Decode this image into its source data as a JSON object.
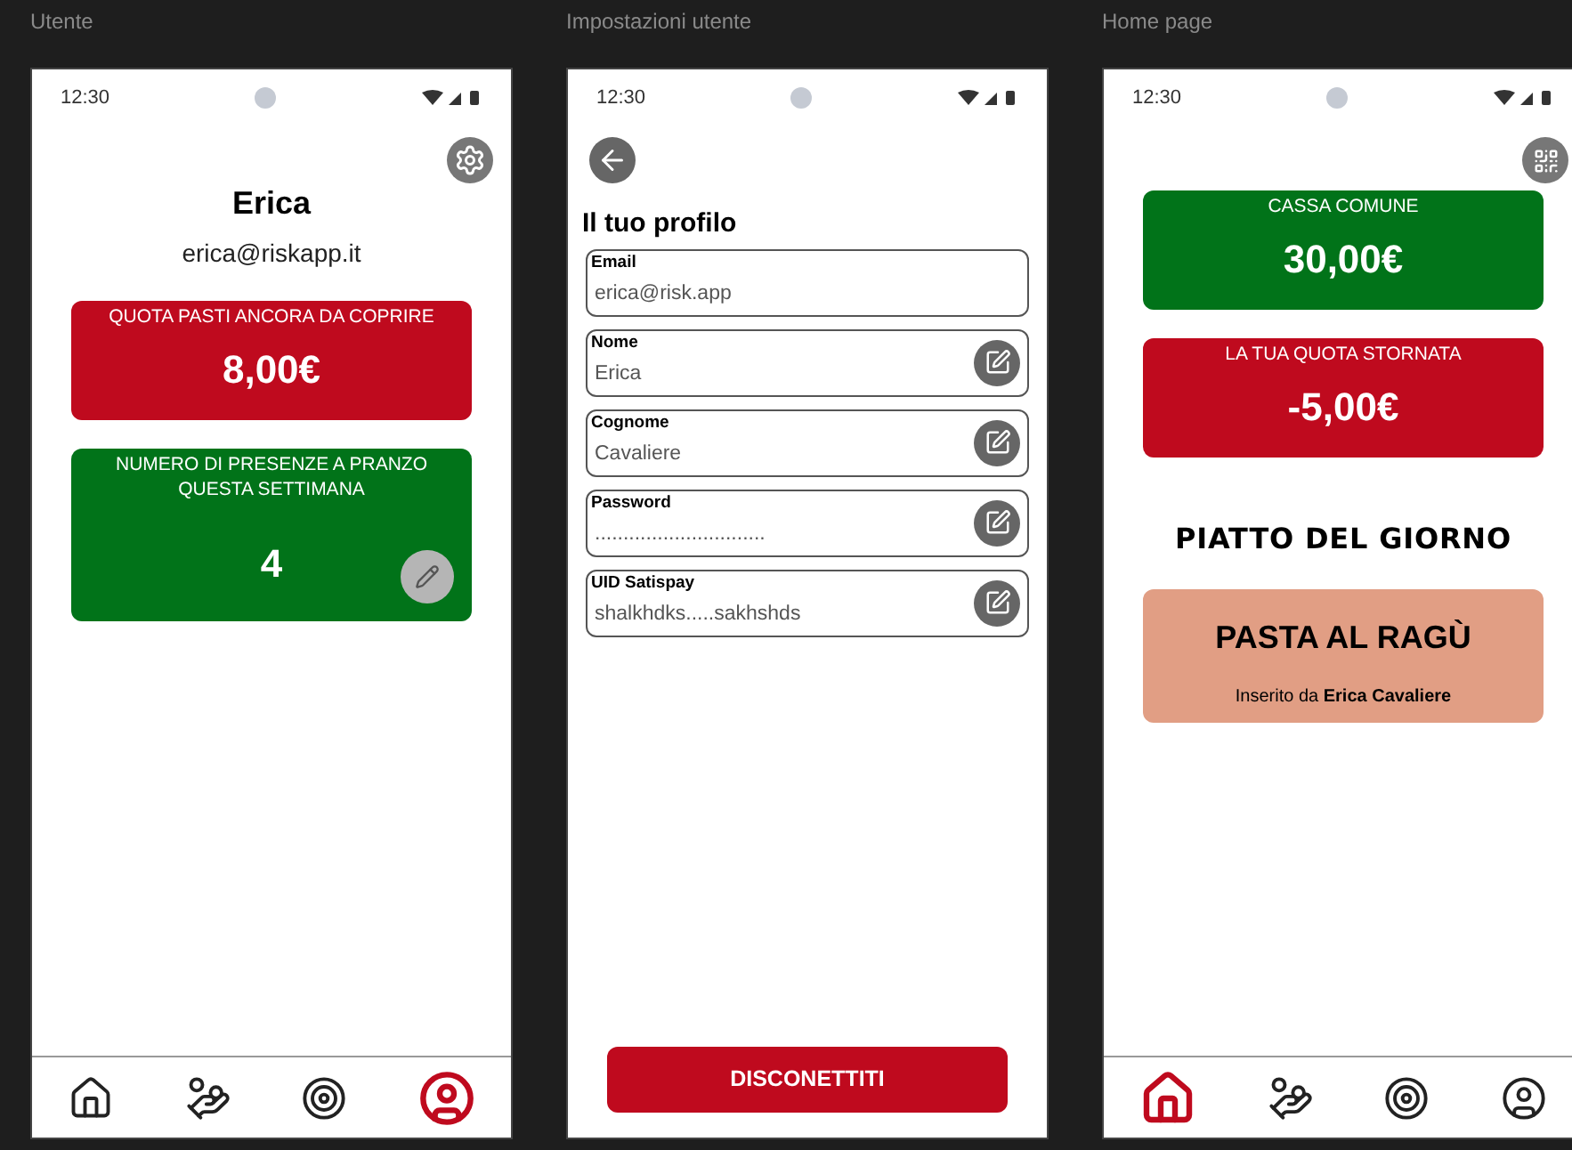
{
  "screens": [
    {
      "kind": "profile",
      "label": "Utente",
      "status_bar": {
        "time": "12:30"
      },
      "name": "Erica",
      "email": "erica@riskapp.it",
      "cards": [
        {
          "title": "QUOTA PASTI ANCORA DA COPRIRE",
          "value": "8,00€",
          "color": "#bf0a1e",
          "editable": false
        },
        {
          "title": "NUMERO DI PRESENZE A PRANZO QUESTA SETTIMANA",
          "value": "4",
          "color": "#017319",
          "editable": true
        }
      ],
      "nav": [
        {
          "kind": "home",
          "selected": false
        },
        {
          "kind": "coins",
          "selected": false
        },
        {
          "kind": "target",
          "selected": false
        },
        {
          "kind": "user",
          "selected": true
        }
      ]
    },
    {
      "kind": "settings",
      "label": "Impostazioni utente",
      "status_bar": {
        "time": "12:30"
      },
      "heading": "Il tuo profilo",
      "fields": [
        {
          "label": "Email",
          "value": "erica@risk.app",
          "editable": false
        },
        {
          "label": "Nome",
          "value": "Erica",
          "editable": true
        },
        {
          "label": "Cognome",
          "value": "Cavaliere",
          "editable": true
        },
        {
          "label": "Password",
          "value": "..............................",
          "editable": true
        },
        {
          "label": "UID Satispay",
          "value": "shalkhdks.....sakhshds",
          "editable": true
        }
      ],
      "button": "DISCONETTITI"
    },
    {
      "kind": "home",
      "label": "Home page",
      "status_bar": {
        "time": "12:30"
      },
      "cards": [
        {
          "title": "CASSA COMUNE",
          "value": "30,00€",
          "color": "#017319",
          "editable": false
        },
        {
          "title": "LA TUA QUOTA STORNATA",
          "value": "-5,00€",
          "color": "#bf0a1e",
          "editable": false
        }
      ],
      "dish_heading": "PIATTO DEL GIORNO",
      "dish": {
        "name": "PASTA AL RAGÙ",
        "note": "Inserito da **Erica Cavaliere**",
        "color": "#e19e84"
      },
      "nav": [
        {
          "kind": "home",
          "selected": true
        },
        {
          "kind": "coins",
          "selected": false
        },
        {
          "kind": "target",
          "selected": false
        },
        {
          "kind": "user",
          "selected": false
        }
      ]
    }
  ]
}
